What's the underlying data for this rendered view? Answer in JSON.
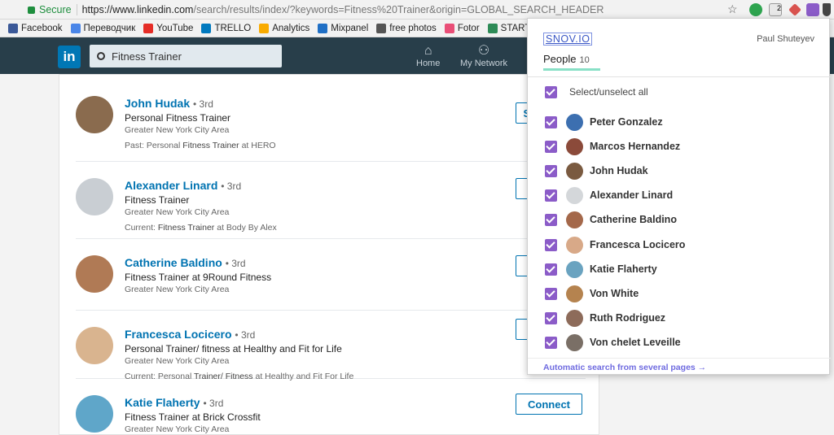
{
  "browser": {
    "secure_label": "Secure",
    "url_host": "https://www.linkedin.com",
    "url_rest": "/search/results/index/?keywords=Fitness%20Trainer&origin=GLOBAL_SEARCH_HEADER",
    "ext_badge": "2"
  },
  "bookmarks": [
    {
      "label": "Facebook",
      "color": "#3b5998"
    },
    {
      "label": "Переводчик",
      "color": "#4a86e8"
    },
    {
      "label": "YouTube",
      "color": "#e52d27"
    },
    {
      "label": "TRELLO",
      "color": "#0079bf"
    },
    {
      "label": "Analytics",
      "color": "#f9ab00"
    },
    {
      "label": "Mixpanel",
      "color": "#1f6fc5"
    },
    {
      "label": "free photos",
      "color": "#555555"
    },
    {
      "label": "Fotor",
      "color": "#e94e77"
    },
    {
      "label": "STARTUP",
      "color": "#2e8b57"
    }
  ],
  "linkedin": {
    "logo": "in",
    "search_value": "Fitness Trainer",
    "nav": {
      "home": "Home",
      "network": "My Network"
    }
  },
  "results": [
    {
      "name": "John Hudak",
      "degree": "• 3rd",
      "title": "Personal Fitness Trainer",
      "location": "Greater New York City Area",
      "current_prefix": "Past: Personal ",
      "current_bold": "Fitness Trainer",
      "current_suffix": " at HERO",
      "button": "Ser",
      "avatar": "#8a6b4e"
    },
    {
      "name": "Alexander Linard",
      "degree": "• 3rd",
      "title": "Fitness Trainer",
      "location": "Greater New York City Area",
      "current_prefix": "Current: ",
      "current_bold": "Fitness Trainer",
      "current_suffix": " at Body By Alex",
      "button": "",
      "avatar": "#c9ced3"
    },
    {
      "name": "Catherine Baldino",
      "degree": "• 3rd",
      "title": "Fitness Trainer at 9Round Fitness",
      "location": "Greater New York City Area",
      "current_prefix": "",
      "current_bold": "",
      "current_suffix": "",
      "button": "",
      "avatar": "#b07a55"
    },
    {
      "name": "Francesca Locicero",
      "degree": "• 3rd",
      "title": "Personal Trainer/ fitness at Healthy and Fit for Life",
      "location": "Greater New York City Area",
      "current_prefix": "Current: Personal ",
      "current_bold": "Trainer/ Fitness",
      "current_suffix": " at Healthy and Fit For Life",
      "button": "",
      "avatar": "#d9b48f"
    },
    {
      "name": "Katie Flaherty",
      "degree": "• 3rd",
      "title": "Fitness Trainer at Brick Crossfit",
      "location": "Greater New York City Area",
      "current_prefix": "",
      "current_bold": "",
      "current_suffix": "",
      "button": "Connect",
      "avatar": "#5fa6c9"
    }
  ],
  "snov": {
    "brand": "SNOV.IO",
    "user": "Paul Shuteyev",
    "tab_label": "People",
    "tab_count": "10",
    "select_all": "Select/unselect all",
    "people": [
      {
        "name": "Peter Gonzalez",
        "avatar": "#3c6fb0"
      },
      {
        "name": "Marcos Hernandez",
        "avatar": "#8b4a3a"
      },
      {
        "name": "John Hudak",
        "avatar": "#7a5a40"
      },
      {
        "name": "Alexander Linard",
        "avatar": "#d4d7da"
      },
      {
        "name": "Catherine Baldino",
        "avatar": "#a4684a"
      },
      {
        "name": "Francesca Locicero",
        "avatar": "#d8a988"
      },
      {
        "name": "Katie Flaherty",
        "avatar": "#6aa3c0"
      },
      {
        "name": "Von White",
        "avatar": "#b5834f"
      },
      {
        "name": "Ruth Rodriguez",
        "avatar": "#8d6b5a"
      },
      {
        "name": "Von chelet Leveille",
        "avatar": "#7a6f66"
      }
    ],
    "auto_search": "Automatic search from several pages →"
  }
}
